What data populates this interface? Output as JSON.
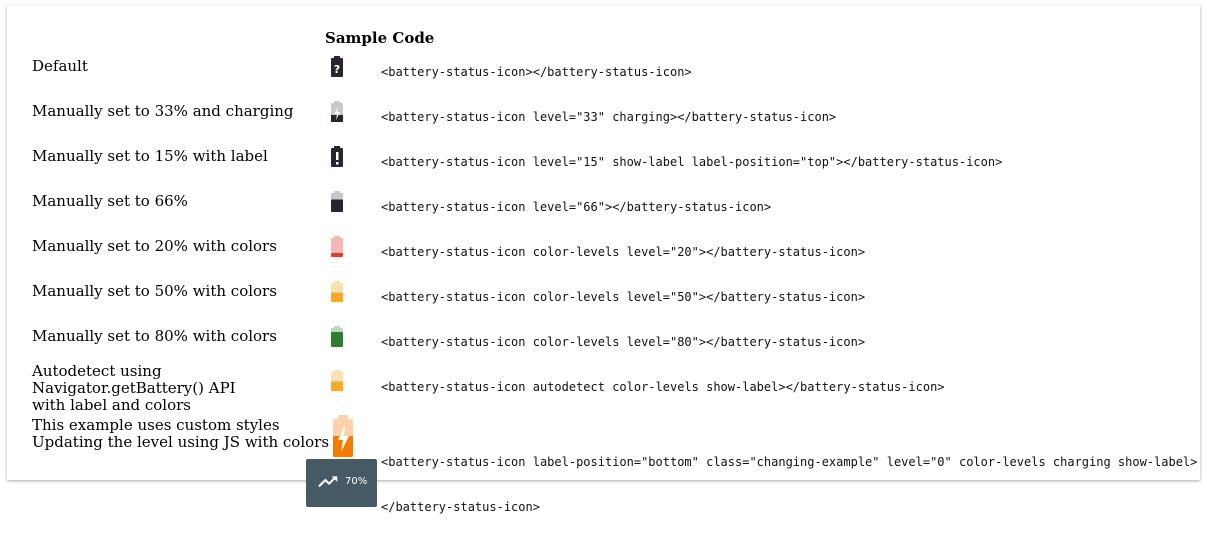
{
  "header": {
    "sample_code": "Sample Code"
  },
  "rows": [
    {
      "label": "Default",
      "code": "<battery-status-icon></battery-status-icon>",
      "icon": "battery-unknown-icon"
    },
    {
      "label": "Manually set to 33% and charging",
      "code": "<battery-status-icon level=\"33\" charging></battery-status-icon>",
      "icon": "battery-charging-icon",
      "level": 0.33
    },
    {
      "label": "Manually set to 15% with label",
      "code": "<battery-status-icon level=\"15\" show-label label-position=\"top\"></battery-status-icon>",
      "icon": "battery-alert-icon",
      "level": 0.15
    },
    {
      "label": "Manually set to 66%",
      "code": "<battery-status-icon level=\"66\"></battery-status-icon>",
      "icon": "battery-icon",
      "level": 0.66
    },
    {
      "label": "Manually set to 20% with colors",
      "code": "<battery-status-icon color-levels level=\"20\"></battery-status-icon>",
      "icon": "battery-icon",
      "level": 0.2,
      "color": "#e53935"
    },
    {
      "label": "Manually set to 50% with colors",
      "code": "<battery-status-icon color-levels level=\"50\"></battery-status-icon>",
      "icon": "battery-icon",
      "level": 0.5,
      "color": "#f9a825"
    },
    {
      "label": "Manually set to 80% with colors",
      "code": "<battery-status-icon color-levels level=\"80\"></battery-status-icon>",
      "icon": "battery-icon",
      "level": 0.8,
      "color": "#2e7d32"
    },
    {
      "label_line1": "Autodetect using Navigator.getBattery() API",
      "label_line2": "with label and colors",
      "code": "<battery-status-icon autodetect color-levels show-label></battery-status-icon>",
      "icon": "battery-icon",
      "level": 0.5,
      "color": "#f9a825"
    },
    {
      "label_line1": "This example uses custom styles",
      "label_line2": "Updating the level using JS with colors",
      "code_line1": "<battery-status-icon label-position=\"bottom\" class=\"changing-example\" level=\"0\" color-levels charging show-label>",
      "code_line2": "</battery-status-icon>",
      "icon": "battery-charging-icon",
      "level": 0.5,
      "color": "#f57c00"
    }
  ],
  "tooltip": {
    "text": "70%",
    "icon": "trending-up-icon"
  }
}
